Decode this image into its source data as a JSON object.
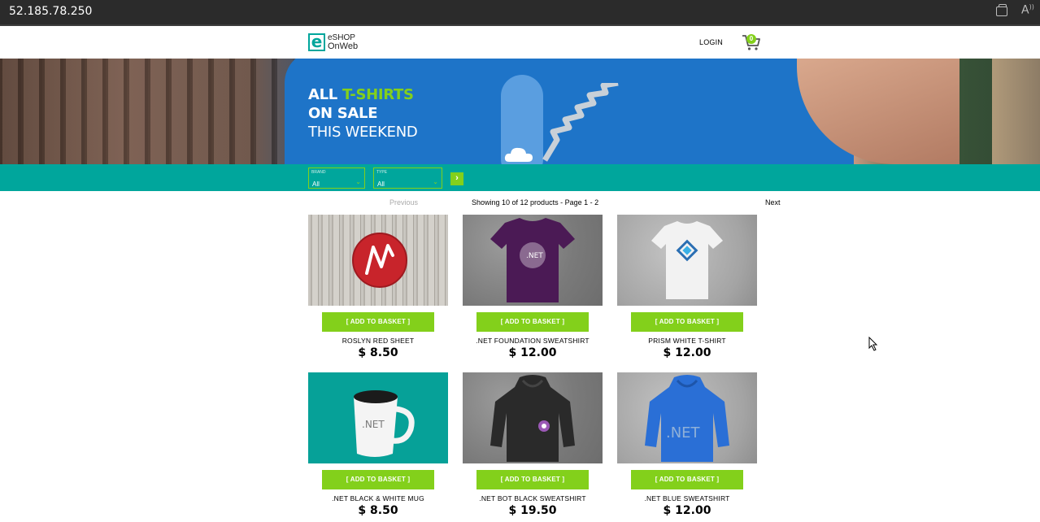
{
  "browser": {
    "address": "52.185.78.250"
  },
  "header": {
    "logo_line1": "eSHOP",
    "logo_line2": "OnWeb",
    "login": "LOGIN",
    "cart_count": "0"
  },
  "banner": {
    "line1_prefix": "ALL ",
    "line1_accent": "T-SHIRTS",
    "line2": "ON SALE",
    "line3": "THIS WEEKEND"
  },
  "filters": {
    "brand": {
      "label": "BRAND",
      "value": "All"
    },
    "type": {
      "label": "TYPE",
      "value": "All"
    }
  },
  "pager": {
    "previous": "Previous",
    "showing": "Showing 10 of 12 products - Page 1 - 2",
    "next": "Next"
  },
  "products": [
    {
      "button": "[ ADD TO BASKET ]",
      "name": "ROSLYN RED SHEET",
      "price": "$ 8.50"
    },
    {
      "button": "[ ADD TO BASKET ]",
      "name": ".NET FOUNDATION SWEATSHIRT",
      "price": "$ 12.00"
    },
    {
      "button": "[ ADD TO BASKET ]",
      "name": "PRISM WHITE T-SHIRT",
      "price": "$ 12.00"
    },
    {
      "button": "[ ADD TO BASKET ]",
      "name": ".NET BLACK & WHITE MUG",
      "price": "$ 8.50"
    },
    {
      "button": "[ ADD TO BASKET ]",
      "name": ".NET BOT BLACK SWEATSHIRT",
      "price": "$ 19.50"
    },
    {
      "button": "[ ADD TO BASKET ]",
      "name": ".NET BLUE SWEATSHIRT",
      "price": "$ 12.00"
    }
  ],
  "image_text": {
    "net_label": ".NET"
  },
  "colors": {
    "brand_teal": "#00a69c",
    "accent_green": "#83d01b",
    "browser_bar": "#2b2b2b"
  }
}
